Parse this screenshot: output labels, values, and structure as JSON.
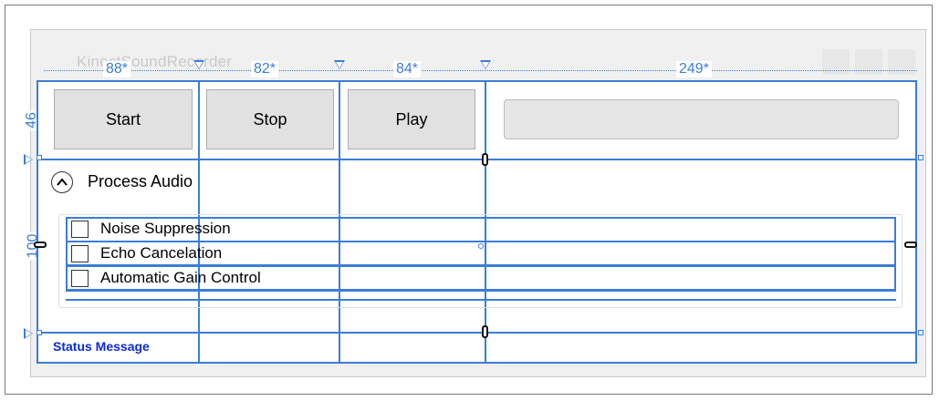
{
  "window": {
    "title": "KinectSoundRecorder"
  },
  "columns": {
    "labels": [
      "88*",
      "82*",
      "84*",
      "249*"
    ]
  },
  "rows": {
    "labels": [
      "46",
      "100"
    ]
  },
  "toolbar": {
    "start_label": "Start",
    "stop_label": "Stop",
    "play_label": "Play"
  },
  "expander": {
    "header": "Process Audio",
    "icon": "chevron-up-icon"
  },
  "options": [
    {
      "label": "Noise Suppression",
      "checked": false
    },
    {
      "label": "Echo Cancelation",
      "checked": false
    },
    {
      "label": "Automatic Gain Control",
      "checked": false
    }
  ],
  "status": {
    "message": "Status Message"
  },
  "colors": {
    "grid_lines": "#3b7dd8",
    "status_text": "#0a2ad8",
    "button_bg": "#e1e1e1"
  }
}
